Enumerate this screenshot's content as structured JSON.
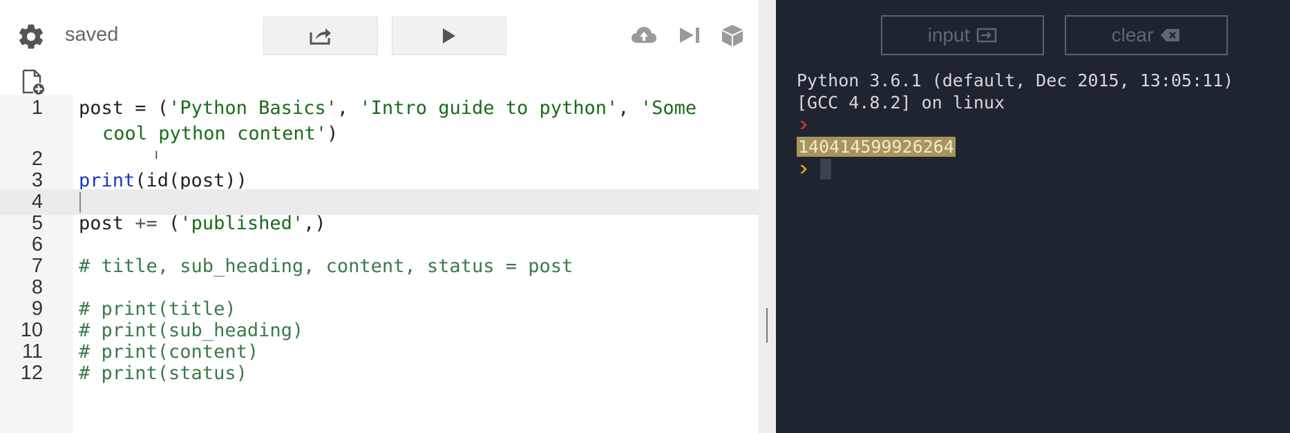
{
  "toolbar": {
    "status": "saved",
    "icons": [
      "gear-icon",
      "share-icon",
      "play-icon",
      "cloud-upload-icon",
      "step-forward-icon",
      "package-icon",
      "new-file-icon"
    ]
  },
  "editor": {
    "active_line": 4,
    "lines": [
      {
        "num": "1",
        "parts": [
          "post",
          " = (",
          "'Python Basics'",
          ", ",
          "'Intro guide to python'",
          ", ",
          "'Some"
        ],
        "wrap": "cool python content'",
        "wrap_tail": ")"
      },
      {
        "num": "2",
        "text": ""
      },
      {
        "num": "3",
        "kw": "print",
        "rest": "(id(post))"
      },
      {
        "num": "4",
        "text": ""
      },
      {
        "num": "5",
        "pre": "post ",
        "op": "+=",
        "mid": " (",
        "str": "'published'",
        "post": ",)"
      },
      {
        "num": "6",
        "text": ""
      },
      {
        "num": "7",
        "comment": "# title, sub_heading, content, status = post"
      },
      {
        "num": "8",
        "text": ""
      },
      {
        "num": "9",
        "comment": "# print(title)"
      },
      {
        "num": "10",
        "comment": "# print(sub_heading)"
      },
      {
        "num": "11",
        "comment": "# print(content)"
      },
      {
        "num": "12",
        "comment": "# print(status)"
      }
    ]
  },
  "console": {
    "input_label": "input",
    "clear_label": "clear",
    "banner_1": "Python 3.6.1 (default, Dec 2015, 13:05:11)",
    "banner_2": "[GCC 4.8.2] on linux",
    "output_value": "140414599926264",
    "colors": {
      "background": "#1e2430",
      "prompt_1": "#c0392b",
      "prompt_2": "#d4a017",
      "highlight": "#a8955a"
    }
  }
}
